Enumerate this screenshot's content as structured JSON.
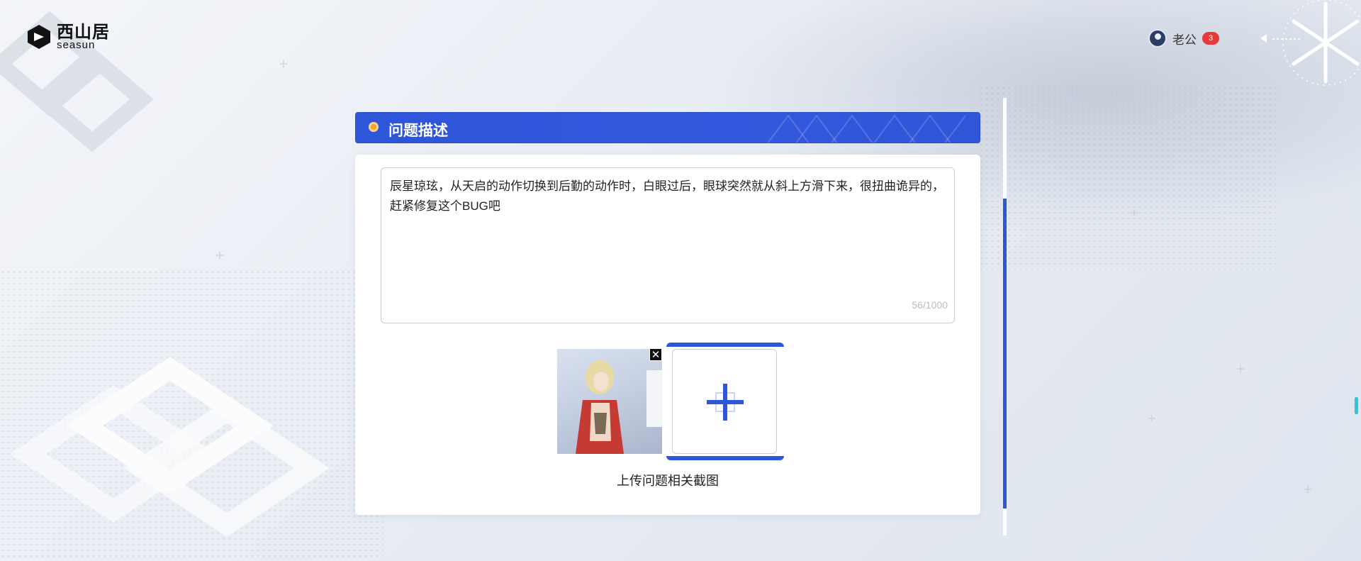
{
  "brand": {
    "name_cn": "西山居",
    "name_en": "seasun"
  },
  "user": {
    "name": "老公",
    "notification_count": "3"
  },
  "section": {
    "title": "问题描述"
  },
  "form": {
    "description": "辰星琼玹，从天启的动作切换到后勤的动作时，白眼过后，眼球突然就从斜上方滑下来，很扭曲诡异的，赶紧修复这个BUG吧",
    "char_count": "56/1000",
    "upload_label": "上传问题相关截图"
  },
  "icons": {
    "logo": "seasun-logo-icon",
    "avatar": "user-avatar-icon",
    "back": "arrow-left-icon",
    "emblem": "game-emblem-icon",
    "title_dot": "bullet-dot-icon",
    "remove": "close-icon",
    "add": "plus-icon"
  },
  "colors": {
    "accent": "#2e56d9",
    "badge": "#e83a3a",
    "bullet": "#f0a43a"
  }
}
